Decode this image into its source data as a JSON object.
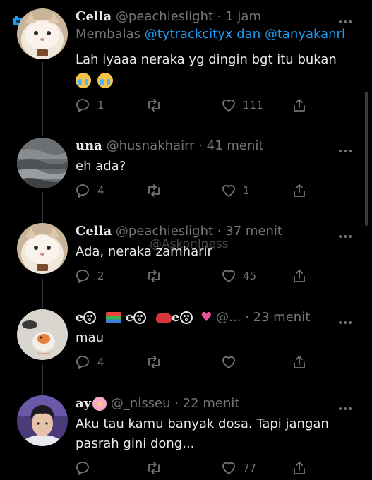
{
  "colors": {
    "background": "#000000",
    "text": "#e7e9ea",
    "secondary": "#71767b",
    "accent": "#1d9bf0"
  },
  "watermark": "@Askonlness",
  "tweets": [
    {
      "name": "Cella",
      "handle": "@peachieslight",
      "sep": "·",
      "time": "1 jam",
      "replying_prefix": "Membalas",
      "replying_users": "@tytrackcityx dan @tanyakanrl",
      "text": "Lah iyaaa neraka yg dingin bgt itu bukan",
      "emoji": [
        "loudly-crying-face",
        "loudly-crying-face"
      ],
      "replies": "1",
      "retweets": "",
      "likes": "111"
    },
    {
      "name": "una",
      "handle": "@husnakhairr",
      "sep": "·",
      "time": "41 menit",
      "text": "eh ada?",
      "replies": "4",
      "retweets": "",
      "likes": "1"
    },
    {
      "name": "Cella",
      "handle": "@peachieslight",
      "sep": "·",
      "time": "37 menit",
      "text": "Ada, neraka zamharir",
      "replies": "2",
      "retweets": "",
      "likes": "45"
    },
    {
      "name_parts": [
        "e",
        "e",
        "e"
      ],
      "name_icons": [
        "astonished-face",
        "books",
        "astonished-face",
        "boxing-glove",
        "astonished-face",
        "sparkling-heart"
      ],
      "handle": "@...",
      "sep": "·",
      "time": "23 menit",
      "text": "mau",
      "replies": "4",
      "retweets": "",
      "likes": ""
    },
    {
      "name": "ay",
      "name_icon": "cherry-blossom",
      "handle": "@_nisseu",
      "sep": "·",
      "time": "22 menit",
      "text_line1": "Aku tau kamu banyak dosa. Tapi jangan",
      "text_line2": "pasrah gini dong...",
      "replies": "",
      "retweets": "",
      "likes": "77"
    }
  ]
}
